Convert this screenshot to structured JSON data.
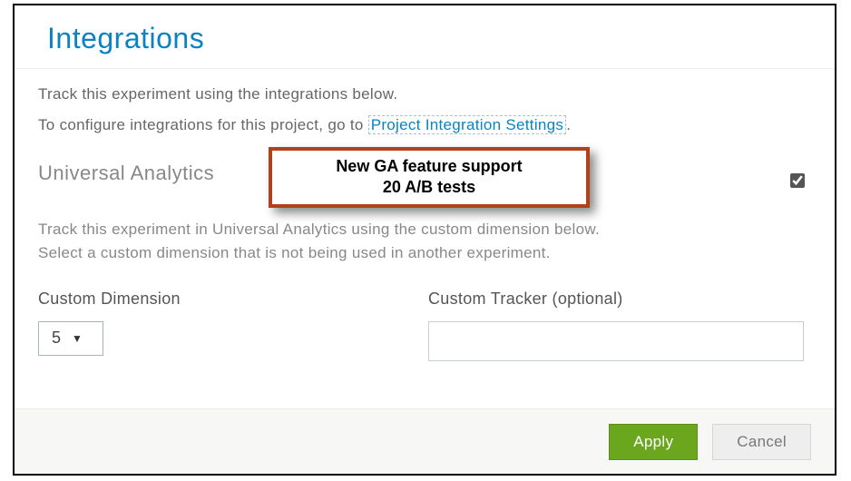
{
  "header": {
    "title": "Integrations"
  },
  "intro": {
    "line1": "Track this experiment using the integrations below.",
    "line2_prefix": "To configure integrations for this project, go to ",
    "link_text": "Project Integration Settings"
  },
  "section": {
    "title": "Universal Analytics",
    "enabled": true,
    "desc_line1": "Track this experiment in Universal Analytics using the custom dimension below.",
    "desc_line2": "Select a custom dimension that is not being used in another experiment."
  },
  "callout": {
    "line1": "New GA feature support",
    "line2": "20 A/B tests"
  },
  "form": {
    "dimension_label": "Custom Dimension",
    "dimension_value": "5",
    "tracker_label": "Custom Tracker (optional)",
    "tracker_value": ""
  },
  "footer": {
    "apply_label": "Apply",
    "cancel_label": "Cancel"
  }
}
